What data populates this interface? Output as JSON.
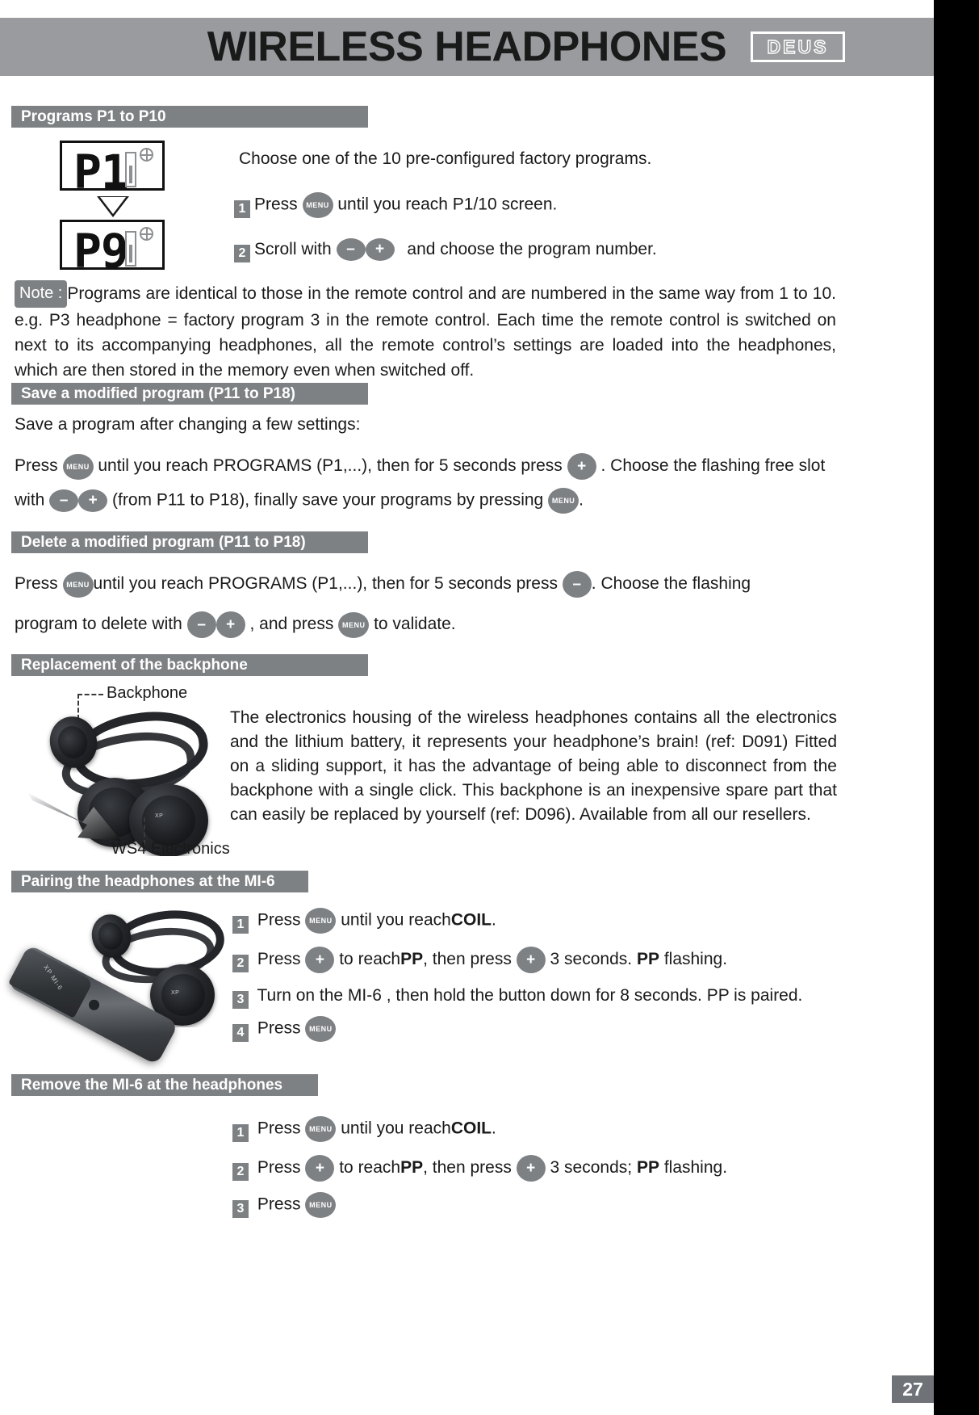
{
  "header": {
    "title": "WIRELESS HEADPHONES",
    "logo_text": "DEUS"
  },
  "sections": {
    "programs": {
      "bar_label": "Programs P1 to P10",
      "lcd_top": "P1",
      "lcd_bottom": "P9",
      "intro": "Choose one of the 10 pre-configured factory programs.",
      "step1_num": "1",
      "step1_a": "Press",
      "step1_btn": "MENU",
      "step1_b": "until you reach P1/10 screen.",
      "step2_num": "2",
      "step2_a": "Scroll with",
      "step2_minus": "–",
      "step2_plus": "+",
      "step2_b": "and choose the program number.",
      "note_badge": "Note :",
      "note_text": "Programs are identical to those in the remote control and are numbered in the same way from 1 to 10. e.g. P3 headphone = factory program 3 in the remote control. Each time the remote control is switched on next to its accompanying headphones, all the remote control’s settings are loaded into the headphones, which are then stored in the memory even when switched off."
    },
    "save": {
      "bar_label": "Save a modified program (P11 to P18)",
      "lead": "Save a program after changing a few settings:",
      "line1_a": "Press",
      "line1_btn": "MENU",
      "line1_b": "until you reach PROGRAMS (P1,...), then for 5 seconds press",
      "line1_plus": "+",
      "line1_c": ". Choose the flashing free slot",
      "line2_a": "with",
      "line2_minus": "–",
      "line2_plus": "+",
      "line2_b": "(from P11 to P18), finally save your programs by pressing",
      "line2_btn": "MENU",
      "line2_c": "."
    },
    "delete": {
      "bar_label": "Delete a modified program (P11 to P18)",
      "line1_a": "Press",
      "line1_btn": "MENU",
      "line1_b": "until you reach PROGRAMS (P1,...), then for 5 seconds press",
      "line1_minus": "–",
      "line1_c": ". Choose the flashing",
      "line2_a": "program to delete with",
      "line2_minus": "–",
      "line2_plus": "+",
      "line2_b": ", and press",
      "line2_btn": "MENU",
      "line2_c": "to validate."
    },
    "backphone": {
      "bar_label": "Replacement of the backphone",
      "callout_top": "Backphone",
      "callout_bottom": "WS4 Electronics",
      "body": "The electronics housing of the wireless headphones contains all the electronics and the lithium battery, it represents your headphone’s brain! (ref: D091) Fitted on a sliding support, it has the advantage of being able to disconnect from the backphone with a single click. This backphone is an inexpensive spare part that can easily be replaced by yourself (ref: D096). Available from all our resellers."
    },
    "pairing": {
      "bar_label": "Pairing the headphones at the MI-6",
      "steps": [
        {
          "num": "1",
          "a": "Press",
          "btn": "MENU",
          "b": "until you reach",
          "bold": "COIL",
          "c": "."
        },
        {
          "num": "2",
          "a": "Press",
          "plus1": "+",
          "b": "to reach",
          "bold1": "PP",
          "c": ", then press",
          "plus2": "+",
          "d": "3 seconds.",
          "bold2": "PP",
          "e": "flashing."
        },
        {
          "num": "3",
          "a": "Turn on the MI-6 , then hold the button down for 8 seconds. PP is paired."
        },
        {
          "num": "4",
          "a": "Press",
          "btn": "MENU"
        }
      ]
    },
    "remove": {
      "bar_label": "Remove the MI-6 at the headphones",
      "steps": [
        {
          "num": "1",
          "a": "Press",
          "btn": "MENU",
          "b": "until you reach",
          "bold": "COIL",
          "c": "."
        },
        {
          "num": "2",
          "a": "Press",
          "plus1": "+",
          "b": "to reach",
          "bold1": "PP",
          "c": ", then press",
          "plus2": "+",
          "d": "3 seconds;",
          "bold2": "PP",
          "e": "flashing."
        },
        {
          "num": "3",
          "a": "Press",
          "btn": "MENU"
        }
      ]
    }
  },
  "footer": {
    "page_number": "27"
  },
  "colors": {
    "band": "#999b9e",
    "bar": "#7e8184",
    "button": "#7e8184",
    "page_number_bg": "#6f7276"
  }
}
